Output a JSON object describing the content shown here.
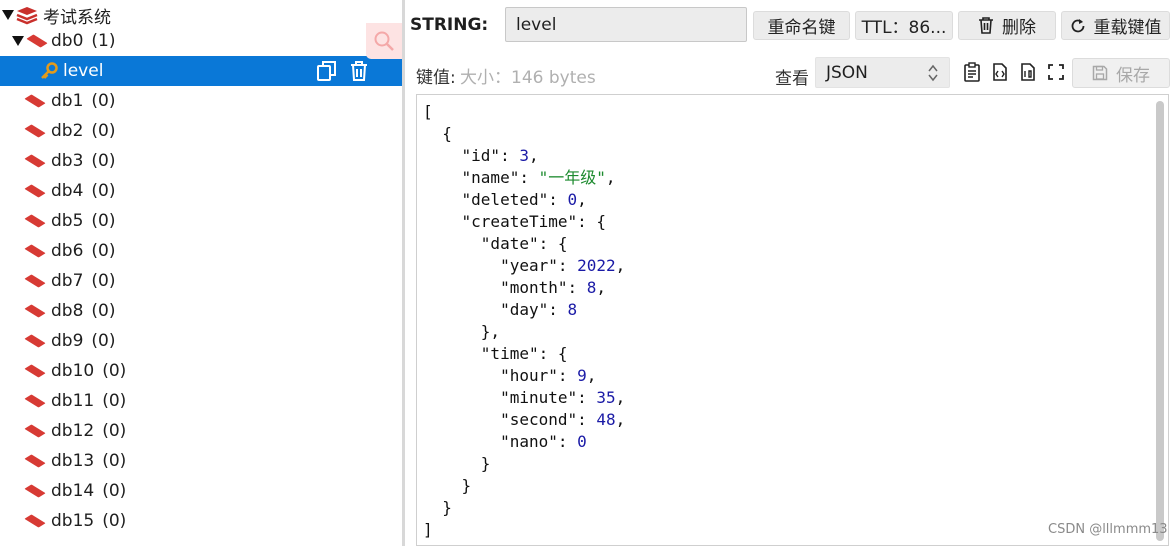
{
  "tree": {
    "root_label": "考试系统",
    "db0": {
      "name": "db0",
      "count": "(1)"
    },
    "key_item": {
      "label": "level"
    },
    "dbs": [
      {
        "name": "db1",
        "count": "(0)"
      },
      {
        "name": "db2",
        "count": "(0)"
      },
      {
        "name": "db3",
        "count": "(0)"
      },
      {
        "name": "db4",
        "count": "(0)"
      },
      {
        "name": "db5",
        "count": "(0)"
      },
      {
        "name": "db6",
        "count": "(0)"
      },
      {
        "name": "db7",
        "count": "(0)"
      },
      {
        "name": "db8",
        "count": "(0)"
      },
      {
        "name": "db9",
        "count": "(0)"
      },
      {
        "name": "db10",
        "count": "(0)"
      },
      {
        "name": "db11",
        "count": "(0)"
      },
      {
        "name": "db12",
        "count": "(0)"
      },
      {
        "name": "db13",
        "count": "(0)"
      },
      {
        "name": "db14",
        "count": "(0)"
      },
      {
        "name": "db15",
        "count": "(0)"
      }
    ]
  },
  "key_panel": {
    "type_label": "STRING:",
    "key_name": "level",
    "rename_label": "重命名键",
    "ttl_label": "TTL：86...",
    "delete_label": "删除",
    "reload_label": "重载键值",
    "value_label": "键值:",
    "size_label": "大小：146 bytes",
    "view_label": "查看",
    "format_value": "JSON",
    "save_label": "保存"
  },
  "editor": {
    "lines": [
      "[",
      "  {",
      "    \"id\": 3,",
      "    \"name\": \"一年级\",",
      "    \"deleted\": 0,",
      "    \"createTime\": {",
      "      \"date\": {",
      "        \"year\": 2022,",
      "        \"month\": 8,",
      "        \"day\": 8",
      "      },",
      "      \"time\": {",
      "        \"hour\": 9,",
      "        \"minute\": 35,",
      "        \"second\": 48,",
      "        \"nano\": 0",
      "      }",
      "    }",
      "  }",
      "]"
    ]
  },
  "watermark": "CSDN @lllmmm13",
  "colors": {
    "selection": "#0a78d7",
    "db_icon": "#d73a34",
    "key_icon": "#e39b1c"
  }
}
